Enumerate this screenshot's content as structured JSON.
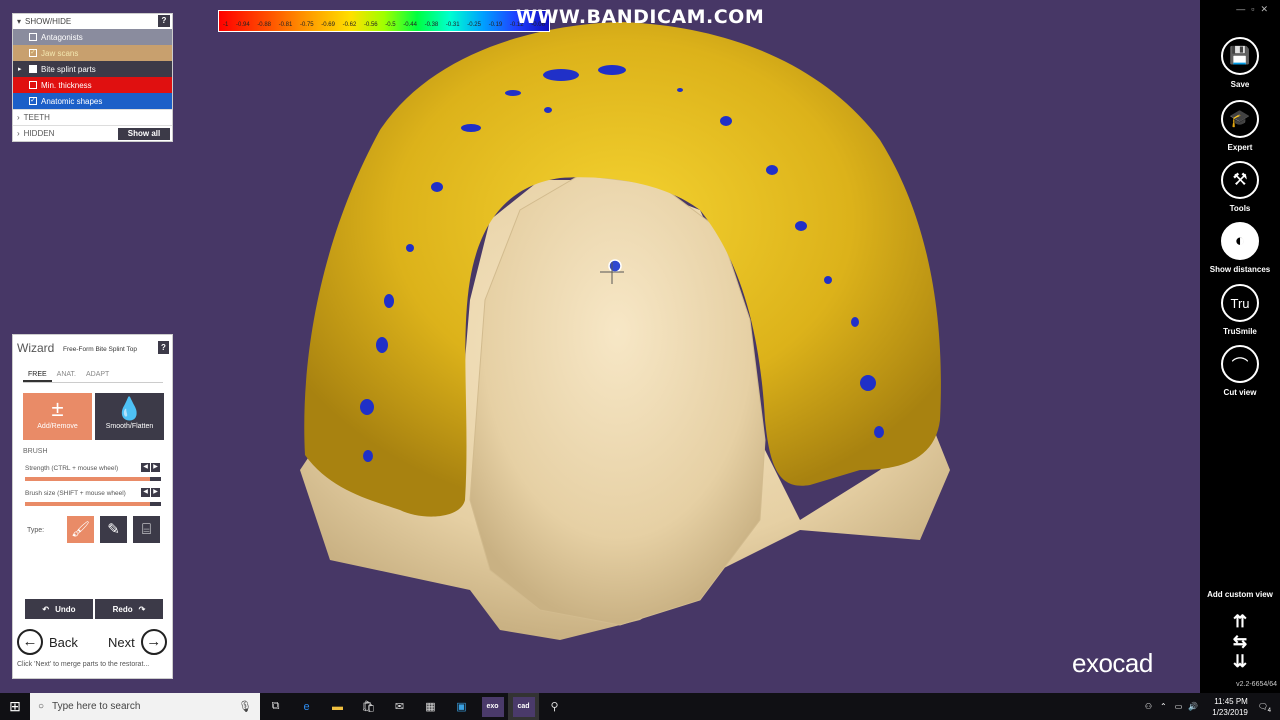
{
  "watermark": "WWW.BANDICAM.COM",
  "colorbar": {
    "ticks": [
      "-1",
      "-0.94",
      "-0.88",
      "-0.81",
      "-0.75",
      "-0.69",
      "-0.62",
      "-0.56",
      "-0.5",
      "-0.44",
      "-0.38",
      "-0.31",
      "-0.25",
      "-0.19",
      "-0.12",
      "-0.06"
    ]
  },
  "show_hide": {
    "title": "SHOW/HIDE",
    "help": "?",
    "items": [
      {
        "label": "Antagonists",
        "checked": false,
        "color": "#8a8c9e"
      },
      {
        "label": "Jaw scans",
        "checked": true,
        "color": "#c8a06e"
      },
      {
        "label": "Bite splint parts",
        "checked": true,
        "color": "#3c3a48"
      },
      {
        "label": "Min. thickness",
        "checked": false,
        "color": "#e01010"
      },
      {
        "label": "Anatomic shapes",
        "checked": true,
        "color": "#1c5fc8"
      }
    ],
    "teeth": "TEETH",
    "hidden": "HIDDEN",
    "show_all": "Show all"
  },
  "wizard": {
    "title": "Wizard",
    "subtitle": "Free-Form Bite Splint Top",
    "help": "?",
    "tabs": [
      "FREE",
      "ANAT.",
      "ADAPT"
    ],
    "add_remove": "Add/Remove",
    "smooth_flatten": "Smooth/Flatten",
    "brush": "BRUSH",
    "strength_label": "Strength (CTRL + mouse wheel)",
    "strength_value": 0.92,
    "size_label": "Brush size (SHIFT + mouse wheel)",
    "size_value": 0.92,
    "type_label": "Type:",
    "undo": "Undo",
    "redo": "Redo",
    "back": "Back",
    "next": "Next",
    "hint": "Click 'Next' to merge parts to the restorat..."
  },
  "rightbar": {
    "items": [
      {
        "label": "Save",
        "icon": "save-icon",
        "glyph": "💾"
      },
      {
        "label": "Expert",
        "icon": "graduation-cap-icon",
        "glyph": "🎓"
      },
      {
        "label": "Tools",
        "icon": "tools-icon",
        "glyph": "⚒"
      },
      {
        "label": "Show distances",
        "icon": "tooth-distance-icon",
        "glyph": "◐"
      },
      {
        "label": "TruSmile",
        "icon": "trusmile-icon",
        "glyph": "Tru"
      },
      {
        "label": "Cut view",
        "icon": "cut-view-icon",
        "glyph": "⌒"
      }
    ],
    "custom_view": "Add custom view",
    "version": "v2.2-6654/64"
  },
  "logo": "exocad",
  "taskbar": {
    "search_placeholder": "Type here to search",
    "apps": [
      "exo",
      "cad"
    ],
    "time": "11:45 PM",
    "date": "1/23/2019",
    "notifications": "4"
  }
}
